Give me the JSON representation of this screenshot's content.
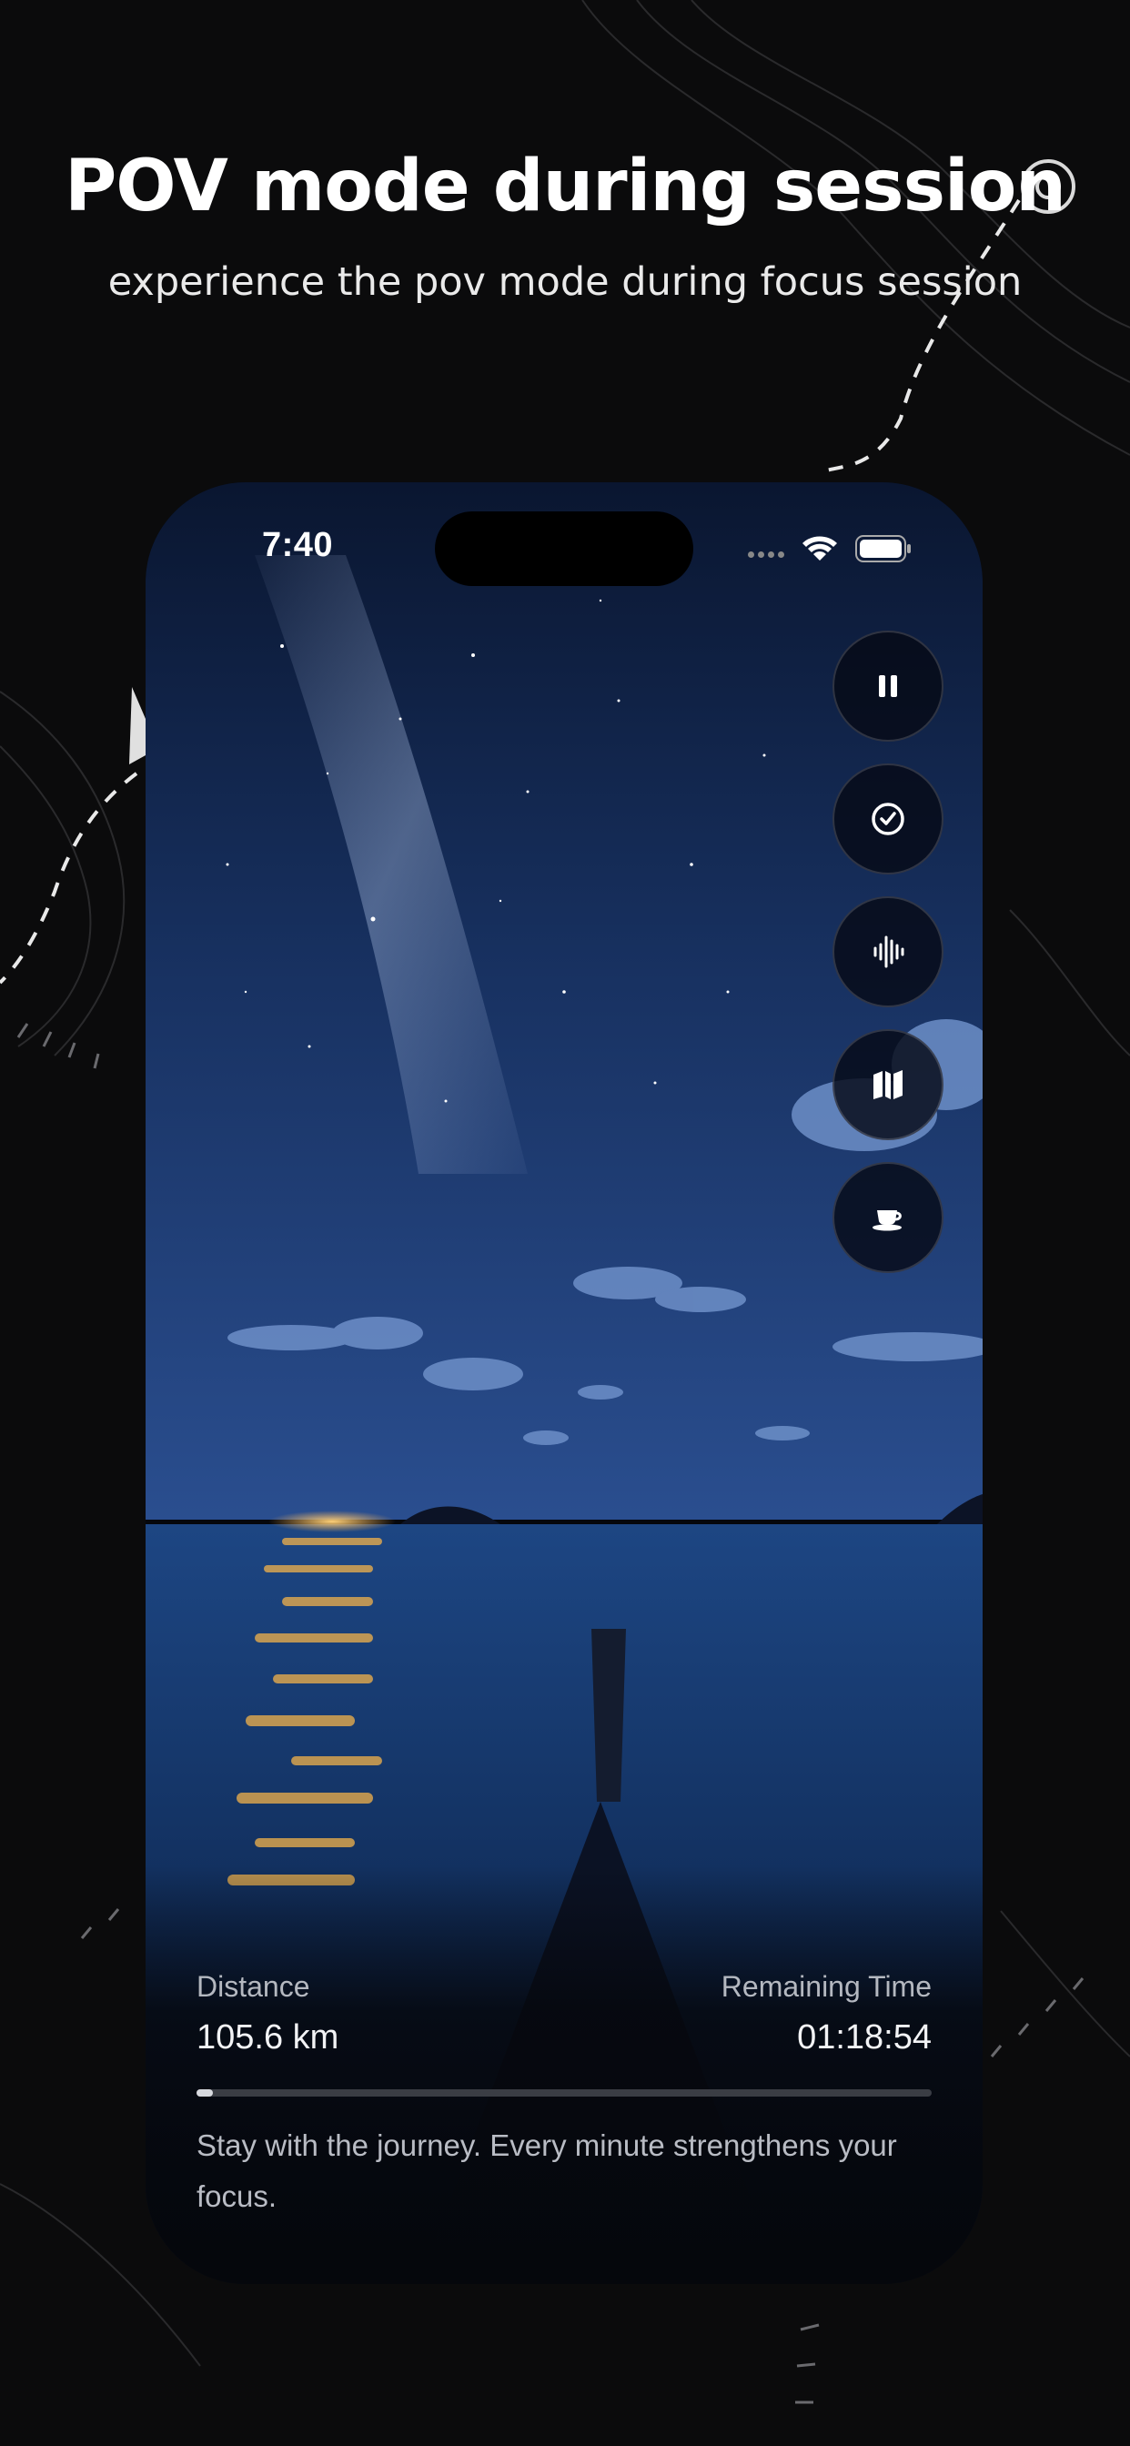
{
  "header": {
    "title": "POV mode during session",
    "subtitle": "experience the pov mode during focus session"
  },
  "status_bar": {
    "time": "7:40",
    "icons": [
      "signal-dots-icon",
      "wifi-icon",
      "battery-icon"
    ]
  },
  "controls": [
    {
      "name": "pause-button",
      "icon": "pause-icon"
    },
    {
      "name": "complete-button",
      "icon": "check-circle-icon"
    },
    {
      "name": "sound-button",
      "icon": "sound-wave-icon"
    },
    {
      "name": "map-button",
      "icon": "map-icon"
    },
    {
      "name": "break-button",
      "icon": "coffee-cup-icon"
    }
  ],
  "journey": {
    "distance_label": "Distance",
    "distance_value": "105.6 km",
    "remaining_label": "Remaining Time",
    "remaining_value": "01:18:54",
    "progress_fraction": 0.02,
    "message": "Stay with the journey. Every minute strengthens your focus."
  },
  "colors": {
    "background": "#0b0b0c",
    "sky_top": "#0a1630",
    "sky_mid": "#1f3f7a",
    "sea": "#143a73",
    "moonlight": "#f2b24a"
  }
}
